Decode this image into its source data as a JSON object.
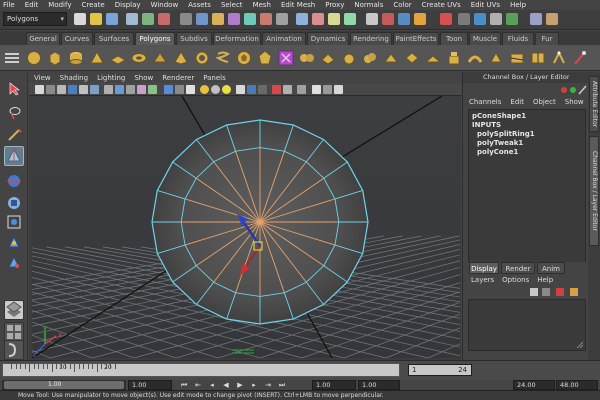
{
  "menubar": {
    "items": [
      "File",
      "Edit",
      "Modify",
      "Create",
      "Display",
      "Window",
      "Assets",
      "Select",
      "Mesh",
      "Edit Mesh",
      "Proxy",
      "Normals",
      "Color",
      "Create UVs",
      "Edit UVs",
      "Help"
    ]
  },
  "statusline": {
    "mode": "Polygons"
  },
  "shelf": {
    "tabs": [
      "General",
      "Curves",
      "Surfaces",
      "Polygons",
      "Subdivs",
      "Deformation",
      "Animation",
      "Dynamics",
      "Rendering",
      "PaintEffects",
      "Toon",
      "Muscle",
      "Fluids",
      "Fur"
    ],
    "active_tab": "Polygons"
  },
  "panel": {
    "menu": [
      "View",
      "Shading",
      "Lighting",
      "Show",
      "Renderer",
      "Panels"
    ]
  },
  "viewport": {
    "background": "#3a3b3d",
    "grid_color": "#8a8f96",
    "wire_color": "#6fd3e8",
    "edge_loop_color": "#e7a36a",
    "axis_labels": {
      "x": "x",
      "y": "y",
      "z": "z"
    }
  },
  "channel_box": {
    "title": "Channel Box / Layer Editor",
    "menu": [
      "Channels",
      "Edit",
      "Object",
      "Show"
    ],
    "shape_name": "pConeShape1",
    "inputs_header": "INPUTS",
    "inputs": [
      "polySplitRing1",
      "polyTweak1",
      "polyCone1"
    ]
  },
  "layer_editor": {
    "tabs": [
      "Display",
      "Render",
      "Anim"
    ],
    "active_tab": "Display",
    "menu": [
      "Layers",
      "Options",
      "Help"
    ]
  },
  "side_tabs": [
    "Attribute Editor",
    "Channel Box / Layer Editor"
  ],
  "time_slider": {
    "tick_labels": [
      "10",
      "20"
    ],
    "current_frame": "1",
    "end_field": "24",
    "start_time": "1.00",
    "range_start": "1.00",
    "range_end": "24.00",
    "end_time": "48.00",
    "current_time": "1.00",
    "range_field": "1.00"
  },
  "help_line": {
    "text": "Move Tool: Use manipulator to move object(s). Use edit mode to change pivot (INSERT).  Ctrl+LMB to move perpendicular."
  }
}
